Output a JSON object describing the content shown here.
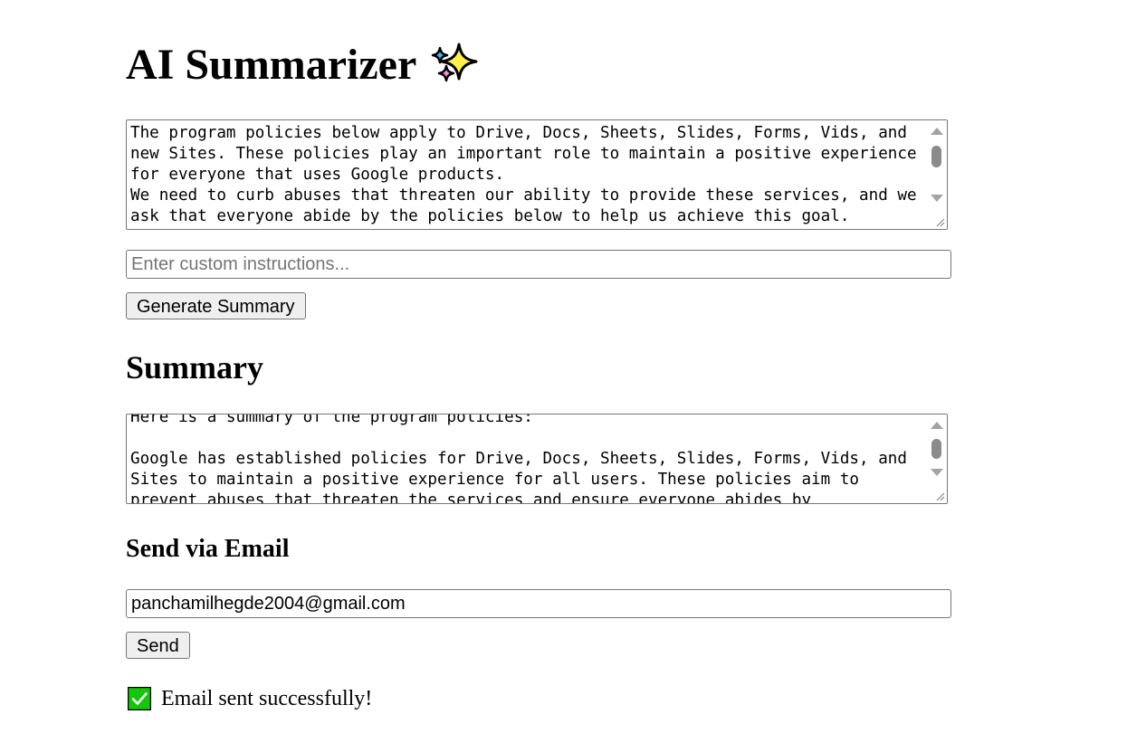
{
  "title": "AI Summarizer",
  "title_icon": "sparkles-icon",
  "source": {
    "text": "The program policies below apply to Drive, Docs, Sheets, Slides, Forms, Vids, and new Sites. These policies play an important role to maintain a positive experience for everyone that uses Google products.\nWe need to curb abuses that threaten our ability to provide these services, and we ask that everyone abide by the policies below to help us achieve this goal."
  },
  "instructions": {
    "placeholder": "Enter custom instructions...",
    "value": ""
  },
  "generate_button": "Generate Summary",
  "summary": {
    "heading": "Summary",
    "text": "Here is a summary of the program policies:\n\nGoogle has established policies for Drive, Docs, Sheets, Slides, Forms, Vids, and Sites to maintain a positive experience for all users. These policies aim to prevent abuses that threaten the services and ensure everyone abides by"
  },
  "email": {
    "heading": "Send via Email",
    "value": "panchamilhegde2004@gmail.com",
    "send_button": "Send"
  },
  "status": {
    "icon": "check-mark-icon",
    "message": "Email sent successfully!",
    "color": "#16c60c"
  }
}
